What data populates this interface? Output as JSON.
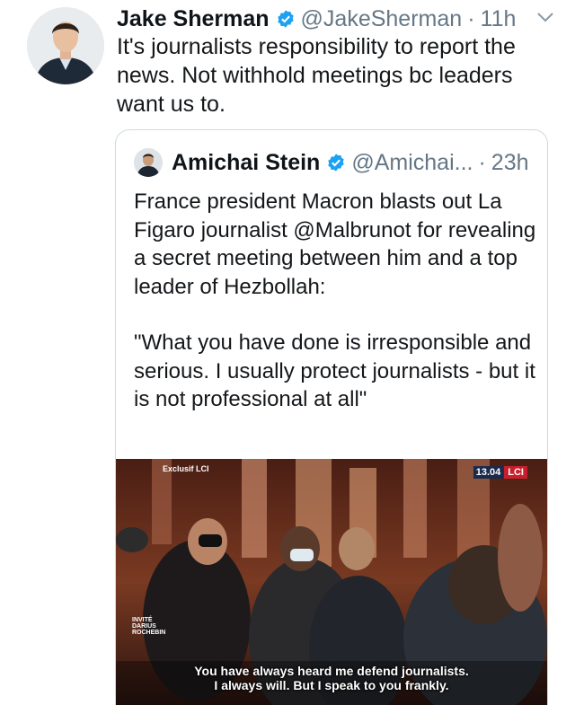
{
  "tweet": {
    "author_name": "Jake Sherman",
    "handle": "@JakeSherman",
    "separator": "·",
    "time": "11h",
    "text": "It's journalists responsibility to report the news. Not withhold meetings bc leaders want us to.",
    "icons": {
      "verified": "verified-badge-icon",
      "menu": "chevron-down-icon"
    },
    "colors": {
      "verified": "#1da1f2",
      "muted": "#657786",
      "border": "#cfd9de"
    }
  },
  "quoted": {
    "author_name": "Amichai Stein",
    "handle": "@Amichai...",
    "separator": "·",
    "time": "23h",
    "paragraph1": "France president Macron blasts out La Figaro journalist @Malbrunot for revealing a secret meeting between him and a top leader of Hezbollah:",
    "paragraph2": "\"What you have done is irresponsible and serious. I usually protect journalists - but it is not professional at all\"",
    "video": {
      "overlay_left": "Exclusif LCI",
      "overlay_time": "13.04",
      "overlay_logo": "LCI",
      "lower_caption_lines": [
        "INVITÉ",
        "DARIUS",
        "ROCHEBIN"
      ],
      "subtitle_line1": "You have always heard me defend journalists.",
      "subtitle_line2": "I always will. But I speak to you frankly."
    }
  }
}
